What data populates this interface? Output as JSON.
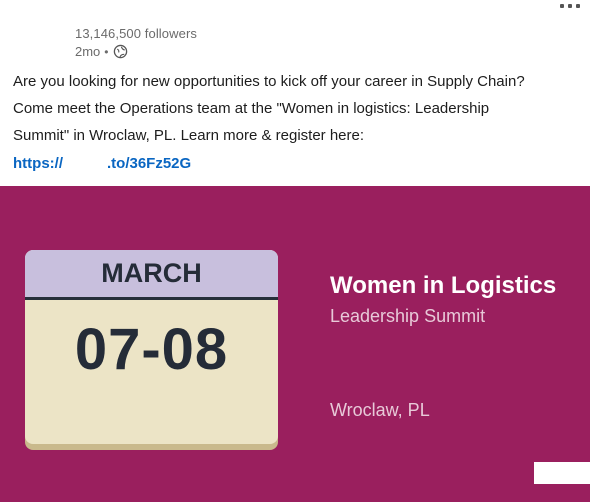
{
  "header": {
    "followers": "13,146,500 followers",
    "age": "2mo",
    "separator": "•",
    "visibility_icon": "globe-icon",
    "more_icon": "more-options-icon"
  },
  "post": {
    "lines": [
      "Are you looking for new opportunities to kick off your career in Supply Chain?",
      "Come meet the Operations team at the \"Women in logistics: Leadership",
      "Summit\" in Wroclaw, PL. Learn more & register here:"
    ],
    "link_prefix": "https://",
    "link_suffix": ".to/36Fz52G"
  },
  "banner": {
    "month": "MARCH",
    "days": "07-08",
    "title": "Women in Logistics",
    "subtitle": "Leadership Summit",
    "location": "Wroclaw, PL",
    "colors": {
      "background": "#9a1f5e",
      "calendar_top": "#c8bfdd",
      "calendar_body": "#ece4c6",
      "calendar_text": "#252c38",
      "link": "#0a66c2"
    }
  }
}
